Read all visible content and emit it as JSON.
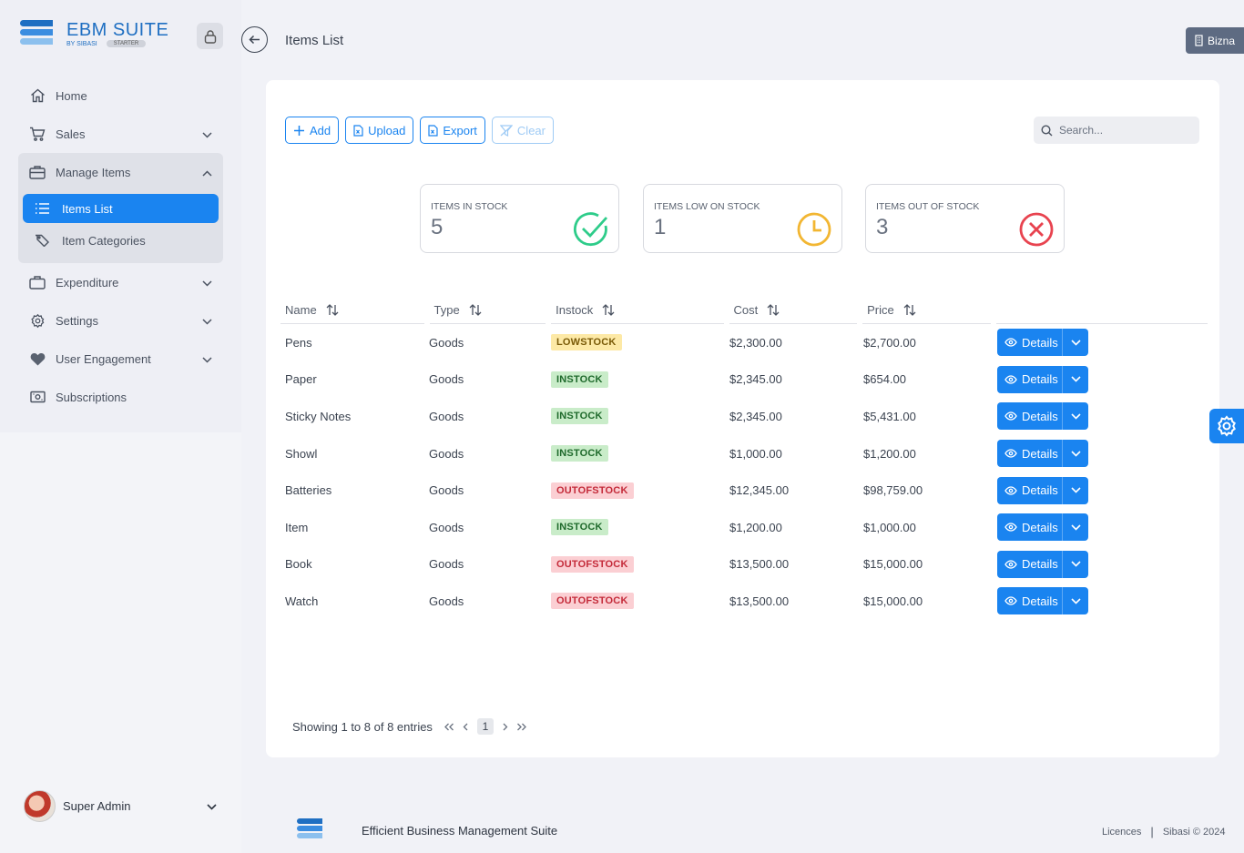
{
  "app": {
    "name": "EBM SUITE",
    "byline": "BY SIBASI",
    "plan_badge": "STARTER",
    "brand_color": "#1a84f0"
  },
  "header": {
    "title": "Items List",
    "org_button": "Bizna"
  },
  "sidebar": {
    "items": [
      {
        "label": "Home",
        "icon": "home-icon"
      },
      {
        "label": "Sales",
        "icon": "cart-icon"
      },
      {
        "label": "Manage Items",
        "icon": "briefcase-icon",
        "expanded": true,
        "children": [
          {
            "label": "Items List",
            "icon": "list-icon",
            "active": true
          },
          {
            "label": "Item Categories",
            "icon": "tag-icon"
          }
        ]
      },
      {
        "label": "Expenditure",
        "icon": "bag-icon"
      },
      {
        "label": "Settings",
        "icon": "gear-icon"
      },
      {
        "label": "User Engagement",
        "icon": "heart-icon"
      },
      {
        "label": "Subscriptions",
        "icon": "money-icon"
      }
    ]
  },
  "user": {
    "name": "Super Admin"
  },
  "toolbar": {
    "add": "Add",
    "upload": "Upload",
    "export": "Export",
    "clear": "Clear"
  },
  "search": {
    "placeholder": "Search..."
  },
  "stats": [
    {
      "label": "ITEMS IN STOCK",
      "value": "5",
      "icon": "check-circle-icon",
      "color": "#2ecc8a"
    },
    {
      "label": "ITEMS LOW ON STOCK",
      "value": "1",
      "icon": "clock-icon",
      "color": "#f2b632"
    },
    {
      "label": "ITEMS OUT OF STOCK",
      "value": "3",
      "icon": "x-circle-icon",
      "color": "#e8434f"
    }
  ],
  "table": {
    "columns": [
      "Name",
      "Type",
      "Instock",
      "Cost",
      "Price"
    ],
    "action_label": "Details",
    "rows": [
      {
        "name": "Pens",
        "type": "Goods",
        "status": "LOWSTOCK",
        "cost": "$2,300.00",
        "price": "$2,700.00"
      },
      {
        "name": "Paper",
        "type": "Goods",
        "status": "INSTOCK",
        "cost": "$2,345.00",
        "price": "$654.00"
      },
      {
        "name": "Sticky Notes",
        "type": "Goods",
        "status": "INSTOCK",
        "cost": "$2,345.00",
        "price": "$5,431.00"
      },
      {
        "name": "Showl",
        "type": "Goods",
        "status": "INSTOCK",
        "cost": "$1,000.00",
        "price": "$1,200.00"
      },
      {
        "name": "Batteries",
        "type": "Goods",
        "status": "OUTOFSTOCK",
        "cost": "$12,345.00",
        "price": "$98,759.00"
      },
      {
        "name": "Item",
        "type": "Goods",
        "status": "INSTOCK",
        "cost": "$1,200.00",
        "price": "$1,000.00"
      },
      {
        "name": "Book",
        "type": "Goods",
        "status": "OUTOFSTOCK",
        "cost": "$13,500.00",
        "price": "$15,000.00"
      },
      {
        "name": "Watch",
        "type": "Goods",
        "status": "OUTOFSTOCK",
        "cost": "$13,500.00",
        "price": "$15,000.00"
      }
    ]
  },
  "pagination": {
    "summary": "Showing 1 to 8 of 8 entries",
    "current_page": "1"
  },
  "footer": {
    "tagline": "Efficient Business Management Suite",
    "licences": "Licences",
    "separator": "|",
    "copyright": "Sibasi © 2024"
  }
}
